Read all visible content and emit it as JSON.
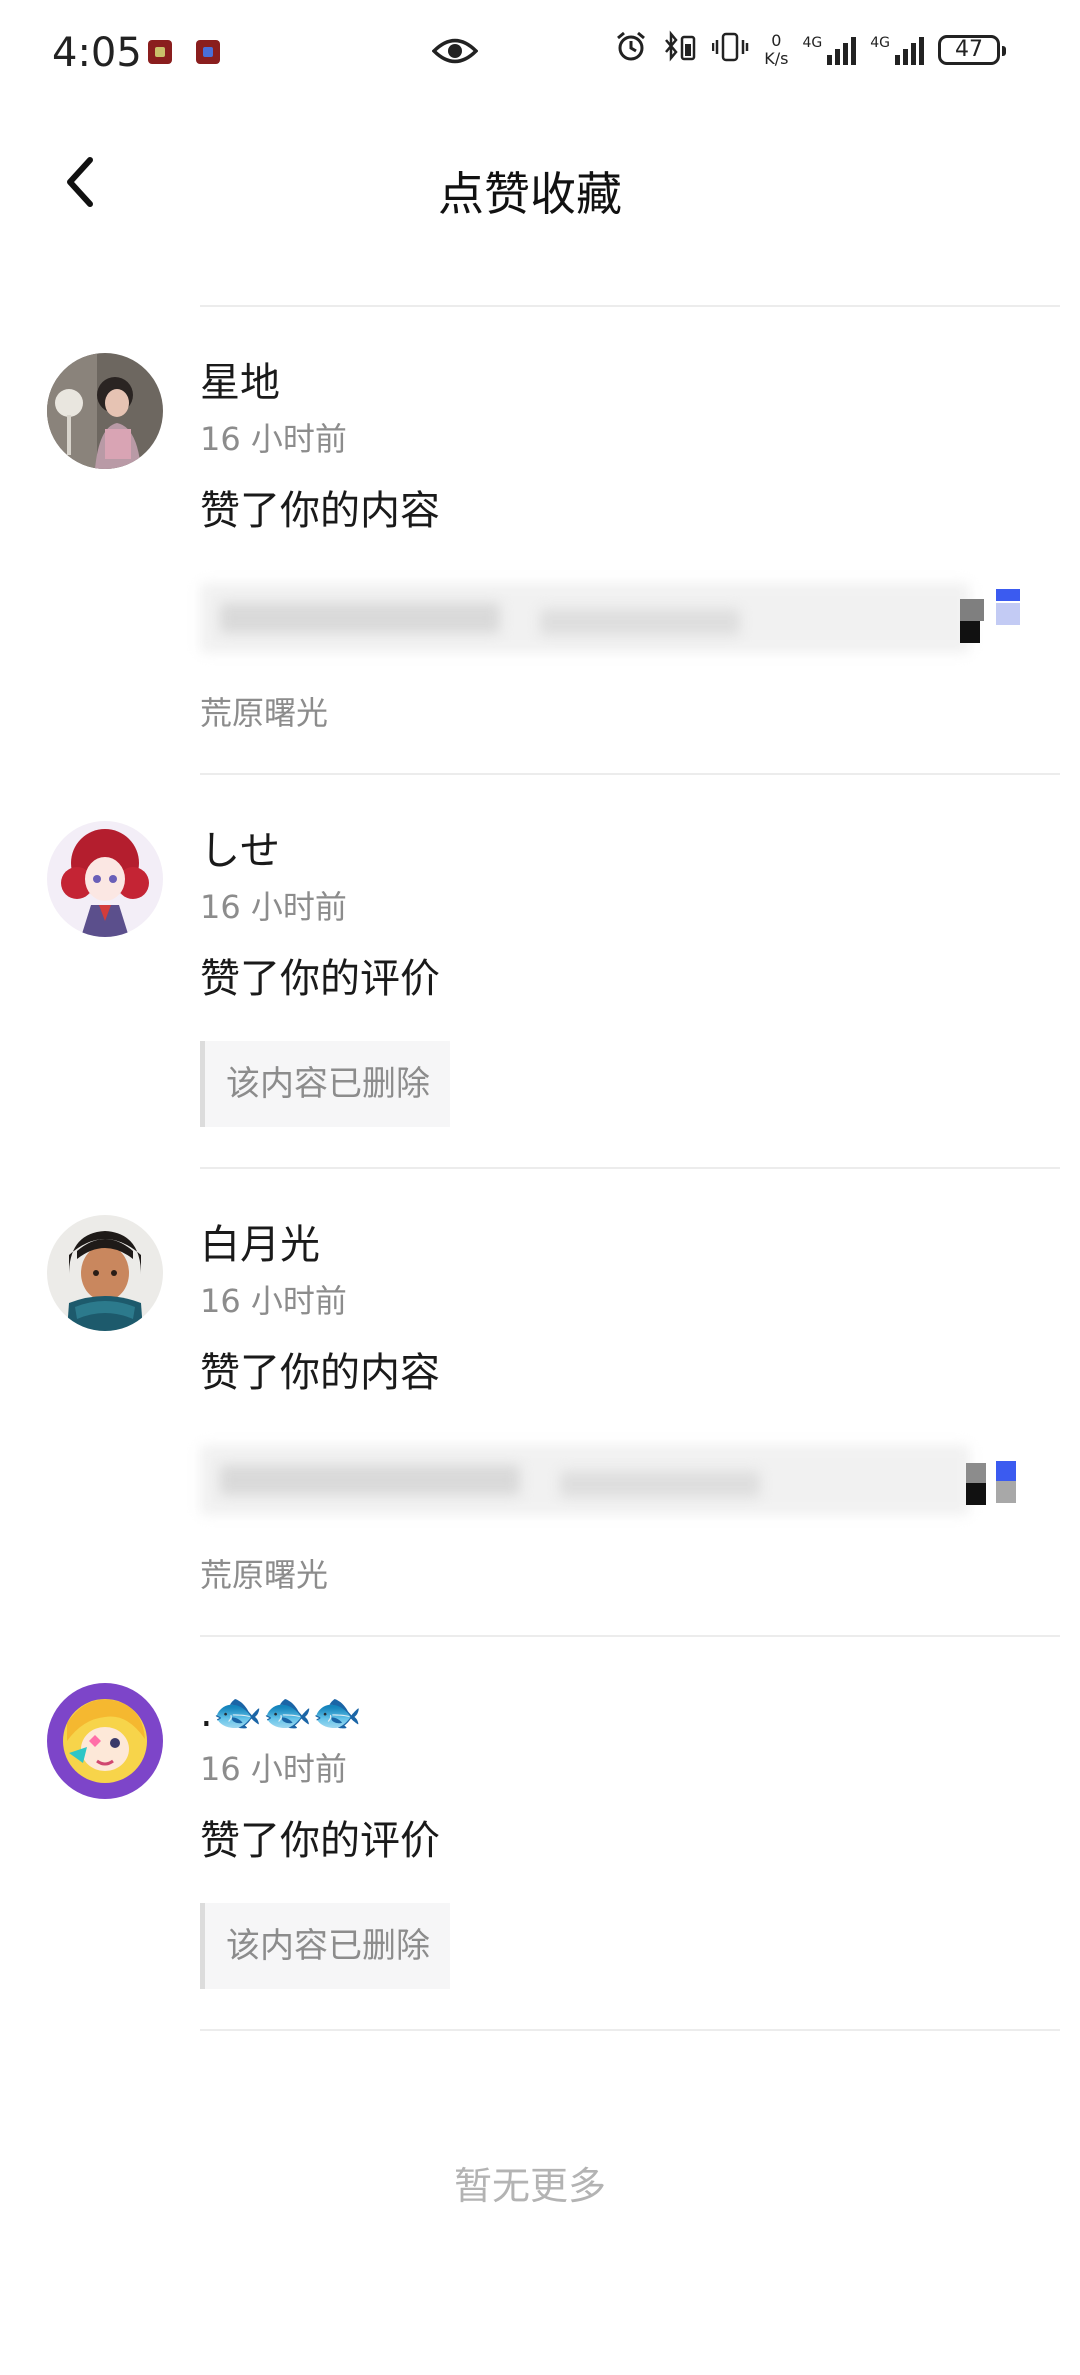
{
  "status_bar": {
    "time": "4:05",
    "net_speed_value": "0",
    "net_speed_unit": "K/s",
    "signal1_label": "4G",
    "signal2_label": "4G",
    "battery": "47"
  },
  "header": {
    "title": "点赞收藏"
  },
  "notifications": [
    {
      "username": "星地",
      "time": "16 小时前",
      "action": "赞了你的内容",
      "source": "荒原曙光"
    },
    {
      "username": "しせ",
      "time": "16 小时前",
      "action": "赞了你的评价",
      "deleted_text": "该内容已删除"
    },
    {
      "username": "白月光",
      "time": "16 小时前",
      "action": "赞了你的内容",
      "source": "荒原曙光"
    },
    {
      "username": ".🐟🐟🐟",
      "time": "16 小时前",
      "action": "赞了你的评价",
      "deleted_text": "该内容已删除"
    }
  ],
  "footer": {
    "no_more": "暂无更多"
  }
}
